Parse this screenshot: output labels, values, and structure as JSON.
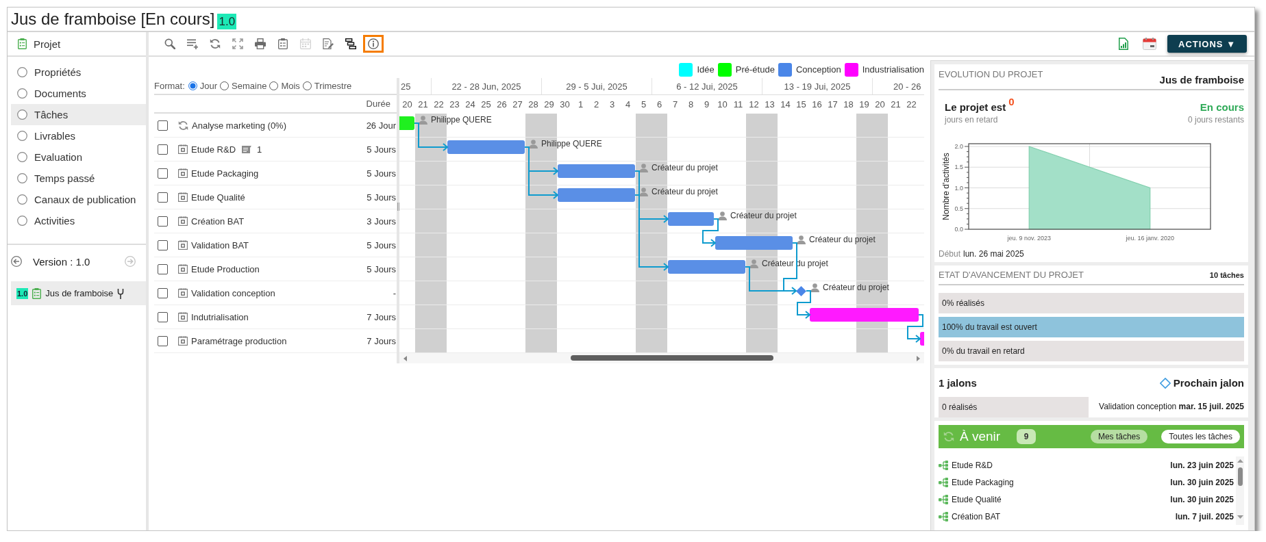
{
  "window": {
    "title": "Jus de framboise [En cours]",
    "version_badge": "1.0"
  },
  "sidebar": {
    "header": "Projet",
    "items": [
      {
        "label": "Propriétés",
        "selected": false
      },
      {
        "label": "Documents",
        "selected": false
      },
      {
        "label": "Tâches",
        "selected": true
      },
      {
        "label": "Livrables",
        "selected": false
      },
      {
        "label": "Evaluation",
        "selected": false
      },
      {
        "label": "Temps passé",
        "selected": false
      },
      {
        "label": "Canaux de publication",
        "selected": false
      },
      {
        "label": "Activities",
        "selected": false
      }
    ],
    "version": {
      "label": "Version : 1.0",
      "nav": [
        {
          "kind": "previous",
          "disabled": false
        },
        {
          "kind": "next",
          "disabled": true
        }
      ]
    },
    "versions": [
      {
        "badge": "1.0",
        "name": "Jus de framboise",
        "selected": true
      }
    ]
  },
  "toolbar": {
    "tools": [
      {
        "kind": "search",
        "disabled": false,
        "selected": false
      },
      {
        "kind": "addrow",
        "disabled": false,
        "selected": false
      },
      {
        "kind": "refresh",
        "disabled": false,
        "selected": false
      },
      {
        "kind": "fullscreen",
        "disabled": false,
        "selected": false
      },
      {
        "kind": "print",
        "disabled": false,
        "selected": false
      },
      {
        "kind": "clipboard",
        "disabled": false,
        "selected": false
      },
      {
        "kind": "calendar",
        "disabled": true,
        "selected": false
      },
      {
        "kind": "edit",
        "disabled": false,
        "selected": false
      },
      {
        "kind": "gantt",
        "disabled": false,
        "selected": false
      },
      {
        "kind": "info",
        "disabled": false,
        "selected": true
      }
    ],
    "actions": "ACTIONS ▼"
  },
  "gantt": {
    "legend": [
      {
        "label": "Idée",
        "color": "#00ffff"
      },
      {
        "label": "Pré-étude",
        "color": "#00ff00"
      },
      {
        "label": "Conception",
        "color": "#4a86e8"
      },
      {
        "label": "Industrialisation",
        "color": "#ff00ff"
      }
    ],
    "format": {
      "label": "Format:",
      "options": [
        {
          "label": "Jour",
          "selected": true
        },
        {
          "label": "Semaine",
          "selected": false
        },
        {
          "label": "Mois",
          "selected": false
        },
        {
          "label": "Trimestre",
          "selected": false
        }
      ]
    },
    "duration_header": "Durée",
    "weeks": [
      {
        "label": "25",
        "days": [
          {
            "label": "20",
            "weekend": false
          },
          {
            "label": "21",
            "weekend": true
          }
        ]
      },
      {
        "label": "22 - 28 Jun, 2025",
        "days": [
          {
            "label": "22",
            "weekend": true
          },
          {
            "label": "23",
            "weekend": false
          },
          {
            "label": "24",
            "weekend": false
          },
          {
            "label": "25",
            "weekend": false
          },
          {
            "label": "26",
            "weekend": false
          },
          {
            "label": "27",
            "weekend": false
          },
          {
            "label": "28",
            "weekend": true
          }
        ]
      },
      {
        "label": "29 - 5 Jui, 2025",
        "days": [
          {
            "label": "29",
            "weekend": true
          },
          {
            "label": "30",
            "weekend": false
          },
          {
            "label": "1",
            "weekend": false
          },
          {
            "label": "2",
            "weekend": false
          },
          {
            "label": "3",
            "weekend": false
          },
          {
            "label": "4",
            "weekend": false
          },
          {
            "label": "5",
            "weekend": true
          }
        ]
      },
      {
        "label": "6 - 12 Jui, 2025",
        "days": [
          {
            "label": "6",
            "weekend": true
          },
          {
            "label": "7",
            "weekend": false
          },
          {
            "label": "8",
            "weekend": false
          },
          {
            "label": "9",
            "weekend": false
          },
          {
            "label": "10",
            "weekend": false
          },
          {
            "label": "11",
            "weekend": false
          },
          {
            "label": "12",
            "weekend": true
          }
        ]
      },
      {
        "label": "13 - 19 Jui, 2025",
        "days": [
          {
            "label": "13",
            "weekend": true
          },
          {
            "label": "14",
            "weekend": false
          },
          {
            "label": "15",
            "weekend": false
          },
          {
            "label": "16",
            "weekend": false
          },
          {
            "label": "17",
            "weekend": false
          },
          {
            "label": "18",
            "weekend": false
          },
          {
            "label": "19",
            "weekend": true
          }
        ]
      },
      {
        "label": "20 - 26",
        "days": [
          {
            "label": "20",
            "weekend": true
          },
          {
            "label": "21",
            "weekend": false
          },
          {
            "label": "22",
            "weekend": false
          }
        ]
      }
    ],
    "tasks": [
      {
        "name": "Analyse marketing (0%)",
        "kind": "recurring",
        "checked": false,
        "duration": "26 Jour",
        "color": "#1ff01f",
        "assignee": "Philippe QUERE"
      },
      {
        "name": "Etude R&D",
        "kind": "task",
        "checked": false,
        "comments": "1",
        "duration": "5 Jours",
        "color": "#5a8fe6",
        "assignee": "Philippe QUERE"
      },
      {
        "name": "Etude Packaging",
        "kind": "task",
        "checked": false,
        "duration": "5 Jours",
        "color": "#5a8fe6",
        "assignee": "Créateur du projet"
      },
      {
        "name": "Etude Qualité",
        "kind": "task",
        "checked": false,
        "duration": "5 Jours",
        "color": "#5a8fe6",
        "assignee": "Créateur du projet"
      },
      {
        "name": "Création BAT",
        "kind": "task",
        "checked": false,
        "duration": "3 Jours",
        "color": "#5a8fe6",
        "assignee": "Créateur du projet"
      },
      {
        "name": "Validation BAT",
        "kind": "task",
        "checked": false,
        "duration": "5 Jours",
        "color": "#5a8fe6",
        "assignee": "Créateur du projet"
      },
      {
        "name": "Etude Production",
        "kind": "task",
        "checked": false,
        "duration": "5 Jours",
        "color": "#5a8fe6",
        "assignee": "Créateur du projet"
      },
      {
        "name": "Validation conception",
        "kind": "milestone",
        "checked": false,
        "duration": "-",
        "color": "#4a86e8",
        "assignee": "Créateur du projet"
      },
      {
        "name": "Indutrialisation",
        "kind": "task",
        "checked": false,
        "duration": "7 Jours",
        "color": "#ff1aff"
      },
      {
        "name": "Paramétrage production",
        "kind": "task",
        "checked": false,
        "duration": "7 Jours",
        "color": "#ff1aff"
      }
    ]
  },
  "evolution": {
    "title": "EVOLUTION DU PROJET",
    "project": "Jus de framboise",
    "status_label": "Le projet est",
    "delay": "0",
    "delay_caption": "jours en retard",
    "state": "En cours",
    "remaining": "0 jours restants",
    "chart_data": {
      "type": "area",
      "ylabel": "Nombre d'activités",
      "categories": [
        "jeu. 9 nov. 2023",
        "jeu. 16 janv. 2020"
      ],
      "values": [
        2,
        1
      ],
      "ylim": [
        0,
        2
      ],
      "yticks": [
        {
          "value": 0,
          "label": "0.0"
        },
        {
          "value": 0.5,
          "label": "0.5"
        },
        {
          "value": 1,
          "label": "1.0"
        },
        {
          "value": 1.5,
          "label": "1.5"
        },
        {
          "value": 2,
          "label": "2.0"
        }
      ],
      "grid": true
    },
    "start_label": "Début",
    "start_date": "lun. 26 mai 2025"
  },
  "progress": {
    "title": "ETAT D'AVANCEMENT DU PROJET",
    "count": "10 tâches",
    "bars": [
      {
        "label": "0% réalisés",
        "level": 0
      },
      {
        "label": "100% du travail est ouvert",
        "level": 1
      },
      {
        "label": "0% du travail en retard",
        "level": 0
      }
    ]
  },
  "milestones": {
    "count": "1 jalons",
    "done": {
      "label": "0 réalisés",
      "level": 0
    },
    "next_title": "Prochain jalon",
    "next": "Validation conception **mar. 15 juil. 2025**"
  },
  "upcoming": {
    "title": "À venir",
    "count": "9",
    "filters": [
      {
        "label": "Mes tâches",
        "selected": false
      },
      {
        "label": "Toutes les tâches",
        "selected": true
      }
    ],
    "items": [
      {
        "name": "Etude R&D",
        "date": "lun. 23 juin 2025"
      },
      {
        "name": "Etude Packaging",
        "date": "lun. 30 juin 2025"
      },
      {
        "name": "Etude Qualité",
        "date": "lun. 30 juin 2025"
      },
      {
        "name": "Création BAT",
        "date": "lun. 7 juil. 2025"
      }
    ]
  }
}
